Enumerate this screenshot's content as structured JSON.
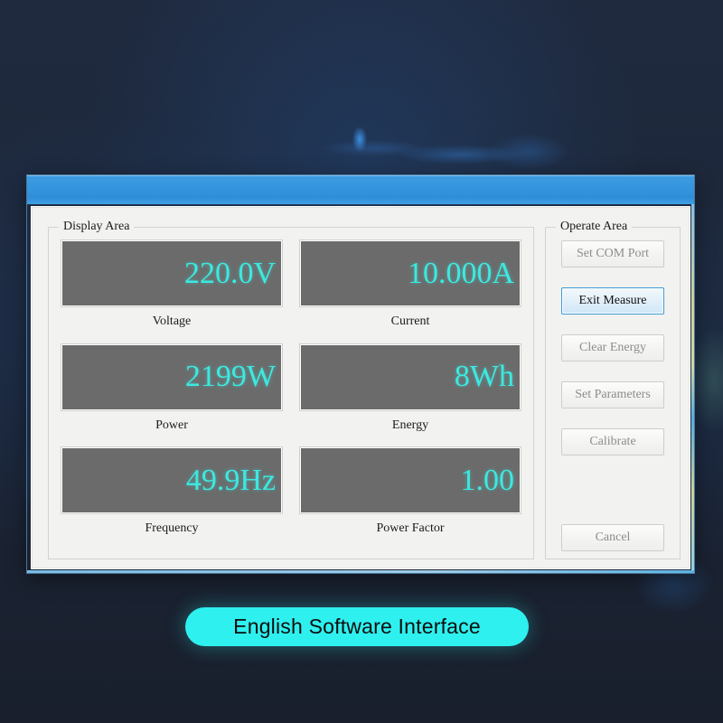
{
  "window": {
    "title": "",
    "title_bar_color": "#3494dd"
  },
  "display_area": {
    "legend": "Display Area",
    "readouts": [
      {
        "value": "220.0V",
        "label": "Voltage"
      },
      {
        "value": "10.000A",
        "label": "Current"
      },
      {
        "value": "2199W",
        "label": "Power"
      },
      {
        "value": "8Wh",
        "label": "Energy"
      },
      {
        "value": "49.9Hz",
        "label": "Frequency"
      },
      {
        "value": "1.00",
        "label": "Power Factor"
      }
    ],
    "value_color": "#3ce9e0",
    "box_color": "#6b6b6b"
  },
  "operate_area": {
    "legend": "Operate Area",
    "buttons": [
      {
        "label": "Set COM Port",
        "focused": false
      },
      {
        "label": "Exit Measure",
        "focused": true
      },
      {
        "label": "Clear Energy",
        "focused": false
      },
      {
        "label": "Set Parameters",
        "focused": false
      },
      {
        "label": "Calibrate",
        "focused": false
      },
      {
        "label": "Cancel",
        "focused": false
      }
    ],
    "focus_color": "#3d9ad6"
  },
  "caption": {
    "text": "English Software Interface",
    "pill_color": "#2ef0ef"
  }
}
